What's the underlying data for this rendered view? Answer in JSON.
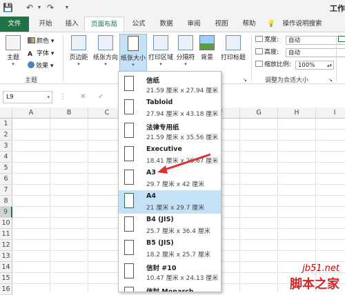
{
  "app": {
    "title_fragment": "工作"
  },
  "tabs": [
    {
      "label": "文件"
    },
    {
      "label": "开始"
    },
    {
      "label": "插入"
    },
    {
      "label": "页面布局"
    },
    {
      "label": "公式"
    },
    {
      "label": "数据"
    },
    {
      "label": "审阅"
    },
    {
      "label": "视图"
    },
    {
      "label": "帮助"
    },
    {
      "label": "操作说明搜索"
    }
  ],
  "ribbon": {
    "themes": {
      "label": "主题",
      "colors": "颜色",
      "fonts": "字体",
      "effects": "效果",
      "group": "主题"
    },
    "margins": "页边距",
    "orientation": "纸张方向",
    "size": "纸张大小",
    "print_area": "打印区域",
    "breaks": "分隔符",
    "background": "背景",
    "print_titles": "打印标题",
    "scale": {
      "width_label": "宽度:",
      "width_value": "自动",
      "height_label": "高度:",
      "height_value": "自动",
      "scale_label": "缩放比例:",
      "scale_value": "100%",
      "group": "调整为合适大小"
    }
  },
  "formula_bar": {
    "name_box": "L9"
  },
  "columns": [
    "A",
    "B",
    "C",
    "D",
    "E",
    "F",
    "G",
    "H",
    "I"
  ],
  "rows": [
    "1",
    "2",
    "3",
    "4",
    "5",
    "6",
    "7",
    "8",
    "9",
    "10",
    "11",
    "12",
    "13",
    "14",
    "15",
    "16"
  ],
  "selected_row": "9",
  "paper_sizes": [
    {
      "name": "信纸",
      "dims": "21.59 厘米 x 27.94 厘米"
    },
    {
      "name": "Tabloid",
      "dims": "27.94 厘米 x 43.18 厘米"
    },
    {
      "name": "法律专用纸",
      "dims": "21.59 厘米 x 35.56 厘米"
    },
    {
      "name": "Executive",
      "dims": "18.41 厘米 x 26.67 厘米"
    },
    {
      "name": "A3",
      "dims": "29.7 厘米 x 42 厘米"
    },
    {
      "name": "A4",
      "dims": "21 厘米 x 29.7 厘米"
    },
    {
      "name": "B4 (JIS)",
      "dims": "25.7 厘米 x 36.4 厘米"
    },
    {
      "name": "B5 (JIS)",
      "dims": "18.2 厘米 x 25.7 厘米"
    },
    {
      "name": "信封 #10",
      "dims": "10.47 厘米 x 24.13 厘米"
    },
    {
      "name": "信封 Monarch",
      "dims": ""
    }
  ],
  "selected_paper": "A4",
  "watermark": {
    "url": "jb51.net",
    "text": "脚本之家"
  },
  "colors": {
    "excel_green": "#217346",
    "highlight": "#c5e1f5",
    "arrow": "#e03030"
  }
}
